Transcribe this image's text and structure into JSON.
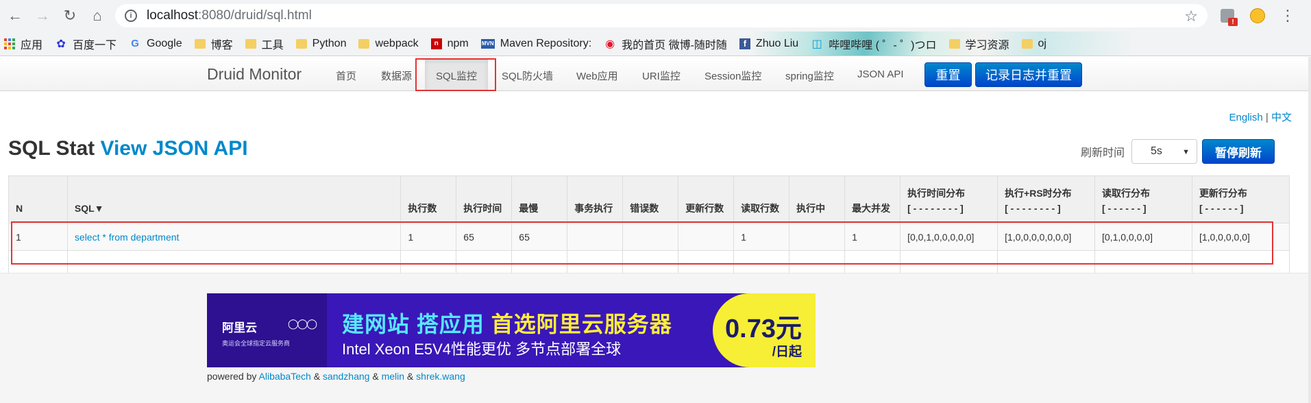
{
  "browser": {
    "url_host": "localhost",
    "url_path": ":8080/druid/sql.html",
    "extension_badge": "!"
  },
  "bookmarks": [
    {
      "label": "应用",
      "icon": "apps-icon"
    },
    {
      "label": "百度一下",
      "icon": "baidu-icon"
    },
    {
      "label": "Google",
      "icon": "google-icon"
    },
    {
      "label": "博客",
      "icon": "folder-icon"
    },
    {
      "label": "工具",
      "icon": "folder-icon"
    },
    {
      "label": "Python",
      "icon": "folder-icon"
    },
    {
      "label": "webpack",
      "icon": "folder-icon"
    },
    {
      "label": "npm",
      "icon": "npm-icon"
    },
    {
      "label": "Maven Repository:",
      "icon": "maven-icon"
    },
    {
      "label": "我的首页 微博-随时随",
      "icon": "weibo-icon"
    },
    {
      "label": "Zhuo Liu",
      "icon": "facebook-icon"
    },
    {
      "label": "哔哩哔哩 ( ゜- ゜)つロ",
      "icon": "bilibili-icon"
    },
    {
      "label": "学习资源",
      "icon": "folder-icon"
    },
    {
      "label": "oj",
      "icon": "folder-icon"
    }
  ],
  "nav": {
    "brand": "Druid Monitor",
    "items": [
      "首页",
      "数据源",
      "SQL监控",
      "SQL防火墙",
      "Web应用",
      "URI监控",
      "Session监控",
      "spring监控",
      "JSON API"
    ],
    "active": "SQL监控",
    "reset_button": "重置",
    "log_reset_button": "记录日志并重置"
  },
  "lang": {
    "english": "English",
    "separator": "|",
    "chinese": "中文"
  },
  "page": {
    "title": "SQL Stat",
    "json_link": "View JSON API",
    "refresh_label": "刷新时间",
    "refresh_value": "5s",
    "pause_button": "暂停刷新"
  },
  "table": {
    "headers": [
      "N",
      "SQL▼",
      "执行数",
      "执行时间",
      "最慢",
      "事务执行",
      "错误数",
      "更新行数",
      "读取行数",
      "执行中",
      "最大并发",
      "执行时间分布",
      "执行+RS时分布",
      "读取行分布",
      "更新行分布"
    ],
    "header_sub": {
      "exec_time_dist": "[ - - - - - - - - ]",
      "exec_rs_dist": "[ - - - - - - - - ]",
      "read_dist": "[ - - - - - - ]",
      "update_dist": "[ - - - - - - ]"
    },
    "rows": [
      [
        "1",
        "select * from department",
        "1",
        "65",
        "65",
        "",
        "",
        "",
        "1",
        "",
        "1",
        "[0,0,1,0,0,0,0,0]",
        "[1,0,0,0,0,0,0,0]",
        "[0,1,0,0,0,0]",
        "[1,0,0,0,0,0]"
      ]
    ]
  },
  "banner": {
    "logo": "阿里云",
    "subtitle": "奥运会全球指定云服务商",
    "headline_a": "建网站 搭应用",
    "headline_b": "首选阿里云服务器",
    "line2": "Intel Xeon E5V4性能更优 多节点部署全球",
    "price": "0.73元",
    "per": "/日起"
  },
  "footer": {
    "prefix": "powered by",
    "authors": [
      "AlibabaTech",
      "sandzhang",
      "melin",
      "shrek.wang"
    ],
    "joiner": "&"
  },
  "colors": {
    "link": "#0088cc",
    "primary": "#0055cc",
    "highlight_box": "#e53333"
  }
}
